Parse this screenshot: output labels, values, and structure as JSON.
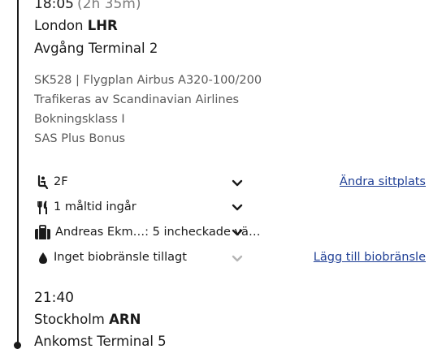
{
  "departure": {
    "time": "18:05",
    "duration": "(2h 35m)",
    "city": "London",
    "code": "LHR",
    "terminal": "Avgång Terminal 2"
  },
  "flight_details": [
    "SK528 | Flygplan Airbus A320-100/200",
    "Trafikeras av Scandinavian Airlines",
    "Bokningsklass I",
    "SAS Plus Bonus"
  ],
  "services": {
    "seat": {
      "icon": "seat-icon",
      "text": "2F",
      "action": "Ändra sittplats"
    },
    "meal": {
      "icon": "cutlery-icon",
      "text": "1 måltid ingår"
    },
    "baggage": {
      "icon": "suitcase-icon",
      "text": "Andreas Ekm…: 5 incheckade vä…"
    },
    "biofuel": {
      "icon": "drop-icon",
      "text": "Inget biobränsle tillagt",
      "action": "Lägg till biobränsle"
    }
  },
  "arrival": {
    "time": "21:40",
    "city": "Stockholm",
    "code": "ARN",
    "terminal": "Ankomst Terminal 5"
  },
  "colors": {
    "text": "#1a1a1a",
    "muted": "#5a5a5a",
    "link": "#1f3f95",
    "chevron_disabled": "#b5b5b5"
  }
}
